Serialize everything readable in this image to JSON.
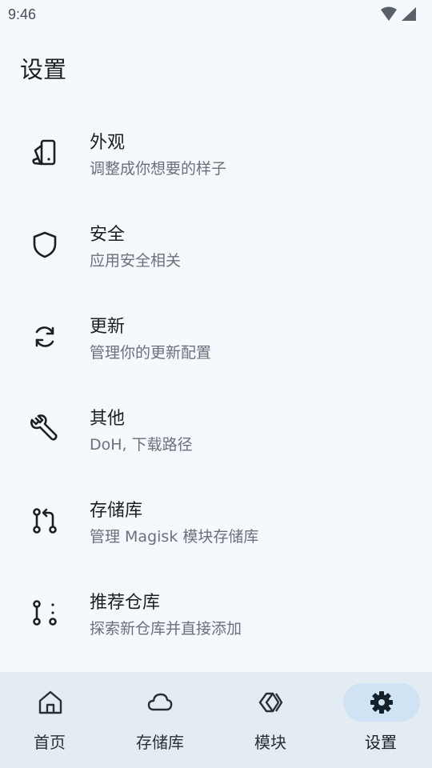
{
  "status_bar": {
    "time": "9:46",
    "icons": [
      "wifi-icon",
      "signal-icon"
    ]
  },
  "page": {
    "title": "设置"
  },
  "settings": [
    {
      "icon": "appearance-icon",
      "title": "外观",
      "subtitle": "调整成你想要的样子"
    },
    {
      "icon": "shield-icon",
      "title": "安全",
      "subtitle": "应用安全相关"
    },
    {
      "icon": "sync-icon",
      "title": "更新",
      "subtitle": "管理你的更新配置"
    },
    {
      "icon": "wrench-icon",
      "title": "其他",
      "subtitle": "DoH, 下载路径"
    },
    {
      "icon": "git-pull-request-icon",
      "title": "存储库",
      "subtitle": "管理 Magisk 模块存储库"
    },
    {
      "icon": "git-pull-request-draft-icon",
      "title": "推荐仓库",
      "subtitle": "探索新仓库并直接添加"
    }
  ],
  "bottom_nav": {
    "items": [
      {
        "icon": "home-icon",
        "label": "首页",
        "active": false
      },
      {
        "icon": "cloud-icon",
        "label": "存储库",
        "active": false
      },
      {
        "icon": "modules-icon",
        "label": "模块",
        "active": false
      },
      {
        "icon": "gear-icon",
        "label": "设置",
        "active": true
      }
    ]
  },
  "colors": {
    "background": "#f5f8fc",
    "nav_background": "#e3ebf3",
    "active_pill": "#cfe3f4",
    "text_primary": "#1b1f24",
    "text_secondary": "#6b7179"
  }
}
